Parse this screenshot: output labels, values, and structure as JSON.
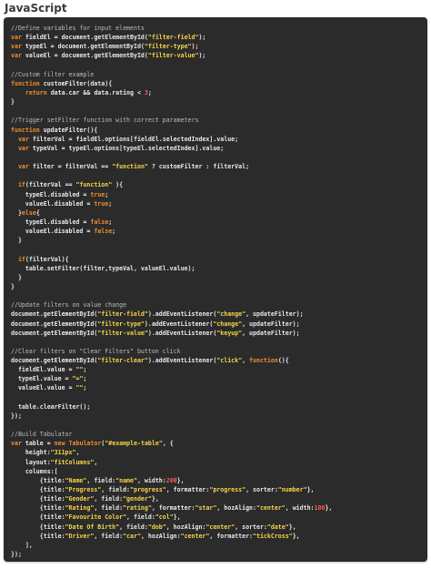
{
  "heading": "JavaScript",
  "code_lines": [
    [
      [
        "cm",
        "//Define variables for input elements"
      ]
    ],
    [
      [
        "kw",
        "var"
      ],
      [
        "pn",
        " fieldEl = document.getElementById("
      ],
      [
        "st",
        "\"filter-field\""
      ],
      [
        "pn",
        ");"
      ]
    ],
    [
      [
        "kw",
        "var"
      ],
      [
        "pn",
        " typeEl = document.getElementById("
      ],
      [
        "st",
        "\"filter-type\""
      ],
      [
        "pn",
        ");"
      ]
    ],
    [
      [
        "kw",
        "var"
      ],
      [
        "pn",
        " valueEl = document.getElementById("
      ],
      [
        "st",
        "\"filter-value\""
      ],
      [
        "pn",
        ");"
      ]
    ],
    [],
    [
      [
        "cm",
        "//Custom filter example"
      ]
    ],
    [
      [
        "kw",
        "function"
      ],
      [
        "pn",
        " customFilter(data){"
      ]
    ],
    [
      [
        "pn",
        "    "
      ],
      [
        "kw",
        "return"
      ],
      [
        "pn",
        " data.car && data.rating < "
      ],
      [
        "nm",
        "3"
      ],
      [
        "pn",
        ";"
      ]
    ],
    [
      [
        "pn",
        "}"
      ]
    ],
    [],
    [
      [
        "cm",
        "//Trigger setFilter function with correct parameters"
      ]
    ],
    [
      [
        "kw",
        "function"
      ],
      [
        "pn",
        " updateFilter(){"
      ]
    ],
    [
      [
        "pn",
        "  "
      ],
      [
        "kw",
        "var"
      ],
      [
        "pn",
        " filterVal = fieldEl.options[fieldEl.selectedIndex].value;"
      ]
    ],
    [
      [
        "pn",
        "  "
      ],
      [
        "kw",
        "var"
      ],
      [
        "pn",
        " typeVal = typeEl.options[typeEl.selectedIndex].value;"
      ]
    ],
    [],
    [
      [
        "pn",
        "  "
      ],
      [
        "kw",
        "var"
      ],
      [
        "pn",
        " filter = filterVal == "
      ],
      [
        "st",
        "\"function\""
      ],
      [
        "pn",
        " ? customFilter : filterVal;"
      ]
    ],
    [],
    [
      [
        "pn",
        "  "
      ],
      [
        "kw",
        "if"
      ],
      [
        "pn",
        "(filterVal == "
      ],
      [
        "st",
        "\"function\""
      ],
      [
        "pn",
        " ){"
      ]
    ],
    [
      [
        "pn",
        "    typeEl.disabled = "
      ],
      [
        "kw",
        "true"
      ],
      [
        "pn",
        ";"
      ]
    ],
    [
      [
        "pn",
        "    valueEl.disabled = "
      ],
      [
        "kw",
        "true"
      ],
      [
        "pn",
        ";"
      ]
    ],
    [
      [
        "pn",
        "  }"
      ],
      [
        "kw",
        "else"
      ],
      [
        "pn",
        "{"
      ]
    ],
    [
      [
        "pn",
        "    typeEl.disabled = "
      ],
      [
        "kw",
        "false"
      ],
      [
        "pn",
        ";"
      ]
    ],
    [
      [
        "pn",
        "    valueEl.disabled = "
      ],
      [
        "kw",
        "false"
      ],
      [
        "pn",
        ";"
      ]
    ],
    [
      [
        "pn",
        "  }"
      ]
    ],
    [],
    [
      [
        "pn",
        "  "
      ],
      [
        "kw",
        "if"
      ],
      [
        "pn",
        "(filterVal){"
      ]
    ],
    [
      [
        "pn",
        "    table.setFilter(filter,typeVal, valueEl.value);"
      ]
    ],
    [
      [
        "pn",
        "  }"
      ]
    ],
    [
      [
        "pn",
        "}"
      ]
    ],
    [],
    [
      [
        "cm",
        "//Update filters on value change"
      ]
    ],
    [
      [
        "pn",
        "document.getElementById("
      ],
      [
        "st",
        "\"filter-field\""
      ],
      [
        "pn",
        ").addEventListener("
      ],
      [
        "st",
        "\"change\""
      ],
      [
        "pn",
        ", updateFilter);"
      ]
    ],
    [
      [
        "pn",
        "document.getElementById("
      ],
      [
        "st",
        "\"filter-type\""
      ],
      [
        "pn",
        ").addEventListener("
      ],
      [
        "st",
        "\"change\""
      ],
      [
        "pn",
        ", updateFilter);"
      ]
    ],
    [
      [
        "pn",
        "document.getElementById("
      ],
      [
        "st",
        "\"filter-value\""
      ],
      [
        "pn",
        ").addEventListener("
      ],
      [
        "st",
        "\"keyup\""
      ],
      [
        "pn",
        ", updateFilter);"
      ]
    ],
    [],
    [
      [
        "cm",
        "//Clear filters on \"Clear Filters\" button click"
      ]
    ],
    [
      [
        "pn",
        "document.getElementById("
      ],
      [
        "st",
        "\"filter-clear\""
      ],
      [
        "pn",
        ").addEventListener("
      ],
      [
        "st",
        "\"click\""
      ],
      [
        "pn",
        ", "
      ],
      [
        "kw",
        "function"
      ],
      [
        "pn",
        "(){"
      ]
    ],
    [
      [
        "pn",
        "  fieldEl.value = "
      ],
      [
        "st",
        "\"\""
      ],
      [
        "pn",
        ";"
      ]
    ],
    [
      [
        "pn",
        "  typeEl.value = "
      ],
      [
        "st",
        "\"=\""
      ],
      [
        "pn",
        ";"
      ]
    ],
    [
      [
        "pn",
        "  valueEl.value = "
      ],
      [
        "st",
        "\"\""
      ],
      [
        "pn",
        ";"
      ]
    ],
    [],
    [
      [
        "pn",
        "  table.clearFilter();"
      ]
    ],
    [
      [
        "pn",
        "});"
      ]
    ],
    [],
    [
      [
        "cm",
        "//Build Tabulator"
      ]
    ],
    [
      [
        "kw",
        "var"
      ],
      [
        "pn",
        " table = "
      ],
      [
        "kw",
        "new"
      ],
      [
        "pn",
        " "
      ],
      [
        "kw",
        "Tabulator"
      ],
      [
        "pn",
        "("
      ],
      [
        "st",
        "\"#example-table\""
      ],
      [
        "pn",
        ", {"
      ]
    ],
    [
      [
        "pn",
        "    height:"
      ],
      [
        "st",
        "\"311px\""
      ],
      [
        "pn",
        ","
      ]
    ],
    [
      [
        "pn",
        "    layout:"
      ],
      [
        "st",
        "\"fitColumns\""
      ],
      [
        "pn",
        ","
      ]
    ],
    [
      [
        "pn",
        "    columns:["
      ]
    ],
    [
      [
        "pn",
        "        {title:"
      ],
      [
        "st",
        "\"Name\""
      ],
      [
        "pn",
        ", field:"
      ],
      [
        "st",
        "\"name\""
      ],
      [
        "pn",
        ", width:"
      ],
      [
        "nm",
        "200"
      ],
      [
        "pn",
        "},"
      ]
    ],
    [
      [
        "pn",
        "        {title:"
      ],
      [
        "st",
        "\"Progress\""
      ],
      [
        "pn",
        ", field:"
      ],
      [
        "st",
        "\"progress\""
      ],
      [
        "pn",
        ", formatter:"
      ],
      [
        "st",
        "\"progress\""
      ],
      [
        "pn",
        ", sorter:"
      ],
      [
        "st",
        "\"number\""
      ],
      [
        "pn",
        "},"
      ]
    ],
    [
      [
        "pn",
        "        {title:"
      ],
      [
        "st",
        "\"Gender\""
      ],
      [
        "pn",
        ", field:"
      ],
      [
        "st",
        "\"gender\""
      ],
      [
        "pn",
        "},"
      ]
    ],
    [
      [
        "pn",
        "        {title:"
      ],
      [
        "st",
        "\"Rating\""
      ],
      [
        "pn",
        ", field:"
      ],
      [
        "st",
        "\"rating\""
      ],
      [
        "pn",
        ", formatter:"
      ],
      [
        "st",
        "\"star\""
      ],
      [
        "pn",
        ", hozAlign:"
      ],
      [
        "st",
        "\"center\""
      ],
      [
        "pn",
        ", width:"
      ],
      [
        "nm",
        "100"
      ],
      [
        "pn",
        "},"
      ]
    ],
    [
      [
        "pn",
        "        {title:"
      ],
      [
        "st",
        "\"Favourite Color\""
      ],
      [
        "pn",
        ", field:"
      ],
      [
        "st",
        "\"col\""
      ],
      [
        "pn",
        "},"
      ]
    ],
    [
      [
        "pn",
        "        {title:"
      ],
      [
        "st",
        "\"Date Of Birth\""
      ],
      [
        "pn",
        ", field:"
      ],
      [
        "st",
        "\"dob\""
      ],
      [
        "pn",
        ", hozAlign:"
      ],
      [
        "st",
        "\"center\""
      ],
      [
        "pn",
        ", sorter:"
      ],
      [
        "st",
        "\"date\""
      ],
      [
        "pn",
        "},"
      ]
    ],
    [
      [
        "pn",
        "        {title:"
      ],
      [
        "st",
        "\"Driver\""
      ],
      [
        "pn",
        ", field:"
      ],
      [
        "st",
        "\"car\""
      ],
      [
        "pn",
        ", hozAlign:"
      ],
      [
        "st",
        "\"center\""
      ],
      [
        "pn",
        ", formatter:"
      ],
      [
        "st",
        "\"tickCross\""
      ],
      [
        "pn",
        "},"
      ]
    ],
    [
      [
        "pn",
        "    ],"
      ]
    ],
    [
      [
        "pn",
        "});"
      ]
    ]
  ],
  "colors": {
    "background": "#2b2b2b",
    "keyword": "#f08d2e",
    "string": "#f5d547",
    "number": "#ff5a5a",
    "comment": "#bdbdbd",
    "text": "#e8e8e8"
  }
}
